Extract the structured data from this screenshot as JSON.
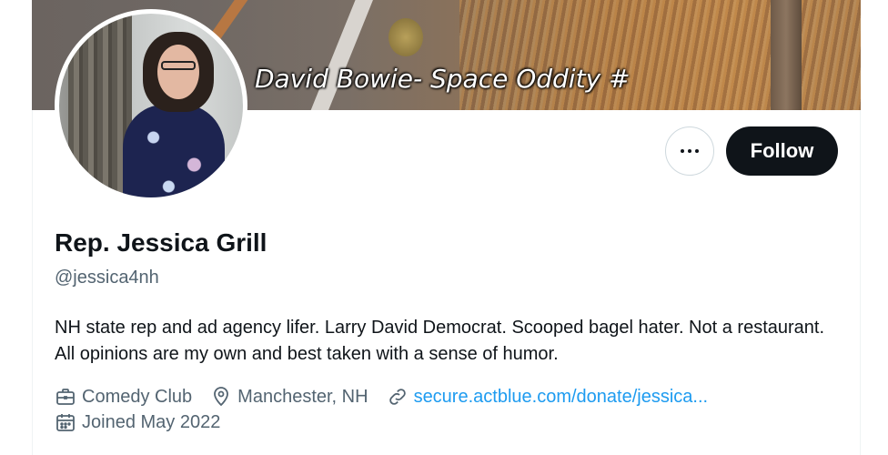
{
  "banner": {
    "caption": "David Bowie- Space Oddity #"
  },
  "profile": {
    "name": "Rep. Jessica Grill",
    "handle": "@jessica4nh",
    "bio": "NH state rep and ad agency lifer. Larry David Democrat. Scooped bagel hater. Not a restaurant. All opinions are my own and best taken with a sense of humor.",
    "category": "Comedy Club",
    "location": "Manchester, NH",
    "website": "secure.actblue.com/donate/jessica...",
    "joined": "Joined May 2022"
  },
  "actions": {
    "follow_label": "Follow"
  },
  "icons": {
    "more": "more-horizontal-icon",
    "category": "briefcase-icon",
    "location": "location-pin-icon",
    "website": "link-icon",
    "joined": "calendar-icon"
  },
  "colors": {
    "text_primary": "#0f1419",
    "text_secondary": "#536471",
    "link": "#1d9bf0",
    "follow_bg": "#0f1419",
    "border": "#cfd9de"
  }
}
